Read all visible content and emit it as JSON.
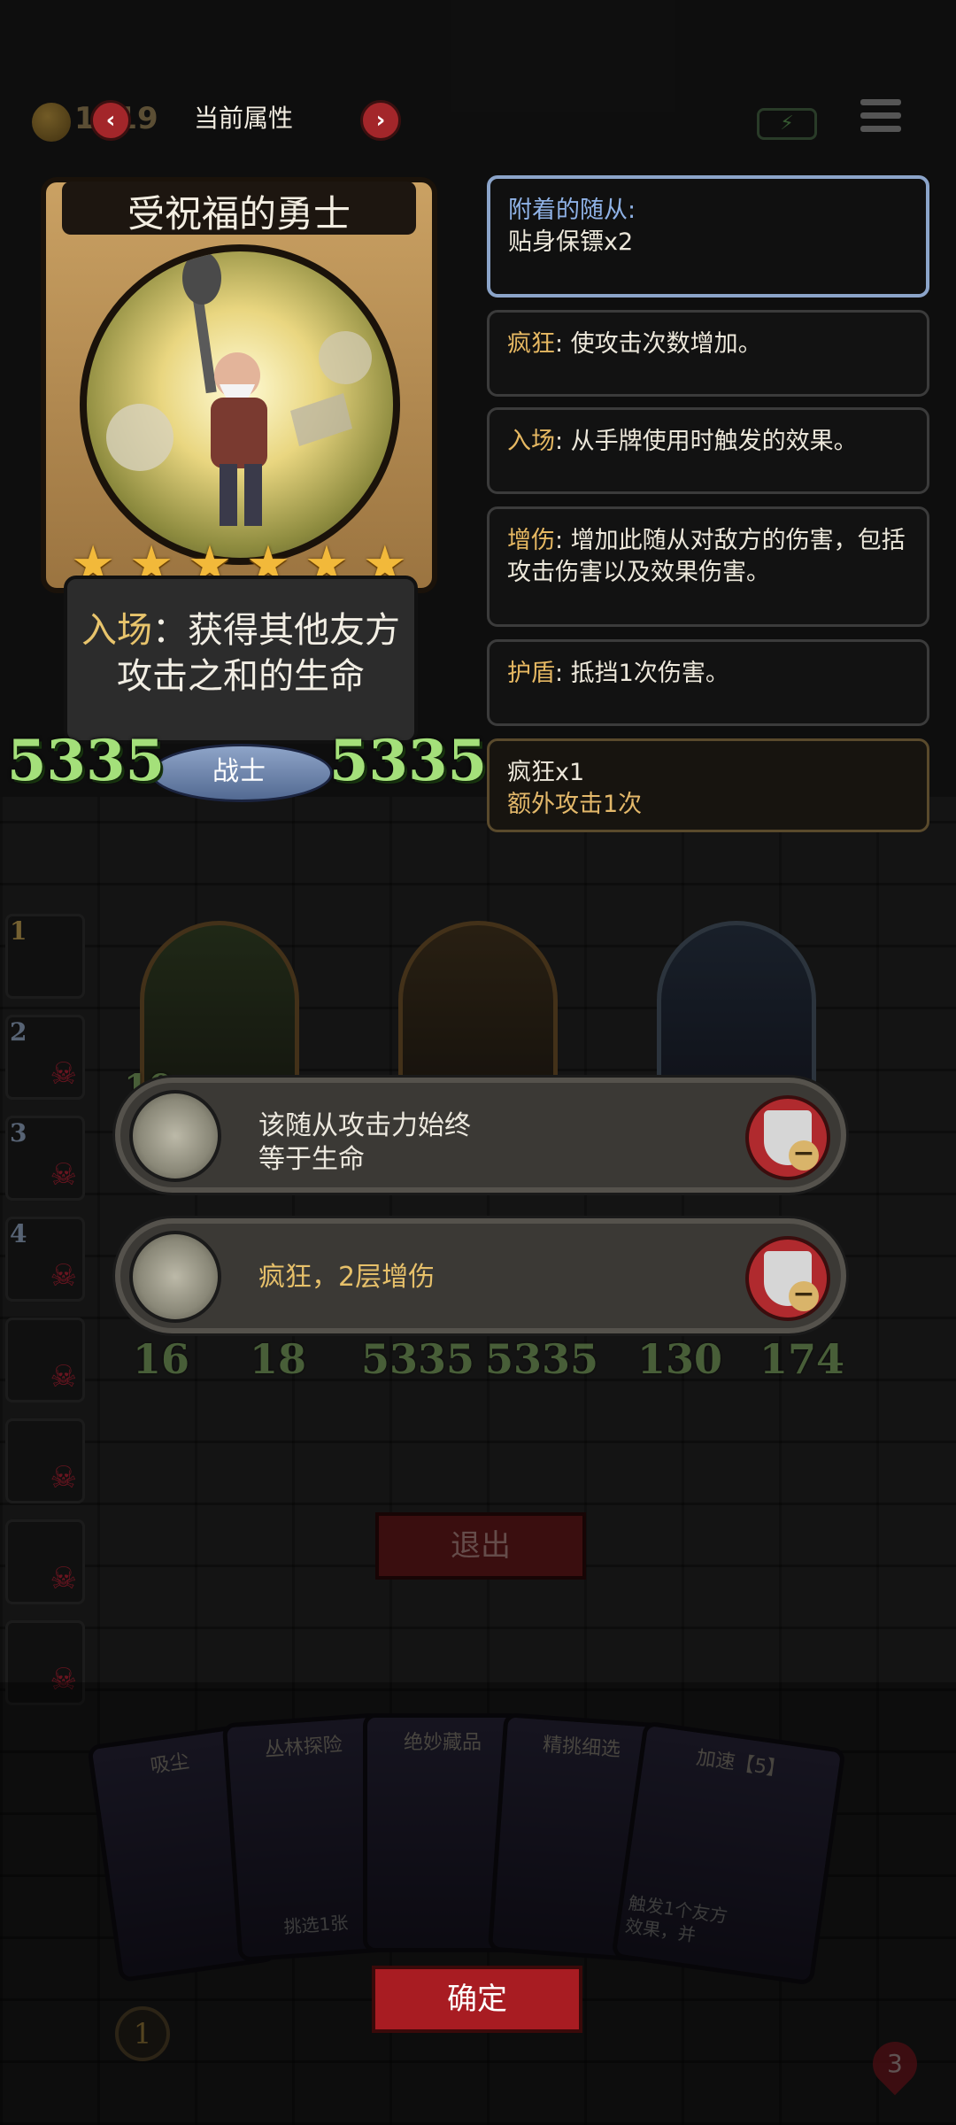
{
  "header": {
    "title": "当前属性",
    "coin_count": "1919",
    "prev_icon": "chevron-left-icon",
    "next_icon": "chevron-right-icon"
  },
  "card": {
    "name": "受祝福的勇士",
    "stars": 6,
    "ability_keyword": "入场",
    "ability_text": "：获得其他友方攻击之和的生命",
    "class_label": "战士",
    "attack": "5335",
    "health": "5335"
  },
  "keywords": {
    "attached": {
      "head": "附着的随从:",
      "body": "贴身保镖x2"
    },
    "frenzy": {
      "kw": "疯狂",
      "body": ": 使攻击次数增加。"
    },
    "enter": {
      "kw": "入场",
      "body": ": 从手牌使用时触发的效果。"
    },
    "damage": {
      "kw": "增伤",
      "body": ": 增加此随从对敌方的伤害，包括攻击伤害以及效果伤害。"
    },
    "shield": {
      "kw": "护盾",
      "body": ": 抵挡1次伤害。"
    },
    "status": {
      "line1": "疯狂x1",
      "line2": "额外攻击1次"
    }
  },
  "sidebar": {
    "slots": [
      {
        "num": "1"
      },
      {
        "num": "2"
      },
      {
        "num": "3"
      },
      {
        "num": "4"
      },
      {
        "num": ""
      },
      {
        "num": ""
      },
      {
        "num": ""
      },
      {
        "num": ""
      }
    ]
  },
  "board": {
    "minion_1": {
      "attack": "16",
      "health": "18"
    },
    "minion_2": {
      "attack": "5335",
      "health": "5335"
    },
    "minion_3": {
      "attack": "130",
      "health": "174"
    },
    "partial_left": "10"
  },
  "buffs": [
    {
      "line1": "该随从攻击力始终",
      "line2": "等于生命"
    },
    {
      "line1": "疯狂，2层增伤",
      "line2": ""
    }
  ],
  "buttons": {
    "exit": "退出",
    "confirm": "确定"
  },
  "hand": [
    {
      "title": "吸尘"
    },
    {
      "title": "丛林探险"
    },
    {
      "title": "绝妙藏品"
    },
    {
      "title": "精挑细选"
    },
    {
      "title": "加速【5】"
    }
  ],
  "hand_snippets": {
    "card_2_bottom": "挑选1张",
    "card_5_bottom_1": "触发1个友方",
    "card_5_bottom_2": "效果，并"
  },
  "bottom": {
    "left_count": "1",
    "right_count": "3"
  },
  "colors": {
    "keyword": "#e6b862",
    "stat_green": "#a4e07a",
    "accent_red": "#a81c22",
    "attached_border": "#8ba4c9"
  }
}
